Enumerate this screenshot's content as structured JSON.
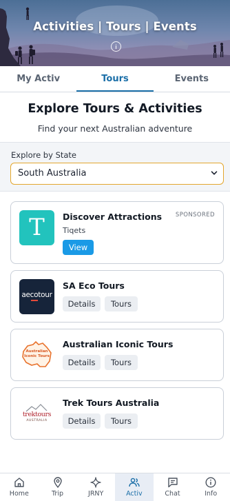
{
  "header": {
    "title": "Activities | Tours | Events",
    "info_icon": "info-circle-icon"
  },
  "tabs": [
    {
      "label": "My Activ",
      "active": false
    },
    {
      "label": "Tours",
      "active": true
    },
    {
      "label": "Events",
      "active": false
    }
  ],
  "intro": {
    "title": "Explore Tours & Activities",
    "subtitle": "Find your next Australian adventure"
  },
  "state_filter": {
    "label": "Explore by State",
    "selected": "South Australia",
    "accent": "#e3a62c"
  },
  "cards": [
    {
      "title": "Discover Attractions",
      "subtitle": "Tiqets",
      "badge": "SPONSORED",
      "logo_icon": "tiqets-logo-icon",
      "logo_text": "T",
      "buttons": [
        "View"
      ]
    },
    {
      "title": "SA Eco Tours",
      "logo_icon": "sa-eco-tours-logo-icon",
      "logo_text": "aecotour",
      "buttons": [
        "Details",
        "Tours"
      ]
    },
    {
      "title": "Australian Iconic Tours",
      "logo_icon": "australian-iconic-tours-logo-icon",
      "logo_text": "Australian Iconic Tours",
      "buttons": [
        "Details",
        "Tours"
      ]
    },
    {
      "title": "Trek Tours Australia",
      "logo_icon": "trek-tours-logo-icon",
      "logo_text": "trektours",
      "logo_subtext": "AUSTRALIA",
      "buttons": [
        "Details",
        "Tours"
      ]
    }
  ],
  "bottom_nav": [
    {
      "label": "Home",
      "icon": "home-icon",
      "active": false
    },
    {
      "label": "Trip",
      "icon": "map-pin-icon",
      "active": false
    },
    {
      "label": "JRNY",
      "icon": "sparkle-icon",
      "active": false
    },
    {
      "label": "Activ",
      "icon": "people-icon",
      "active": true
    },
    {
      "label": "Chat",
      "icon": "chat-icon",
      "active": false
    },
    {
      "label": "Info",
      "icon": "info-icon",
      "active": false
    }
  ],
  "colors": {
    "primary": "#1b6fa8",
    "button_blue": "#1a9ae6",
    "tiqets_teal": "#22c3bd",
    "eco_navy": "#16243a"
  }
}
